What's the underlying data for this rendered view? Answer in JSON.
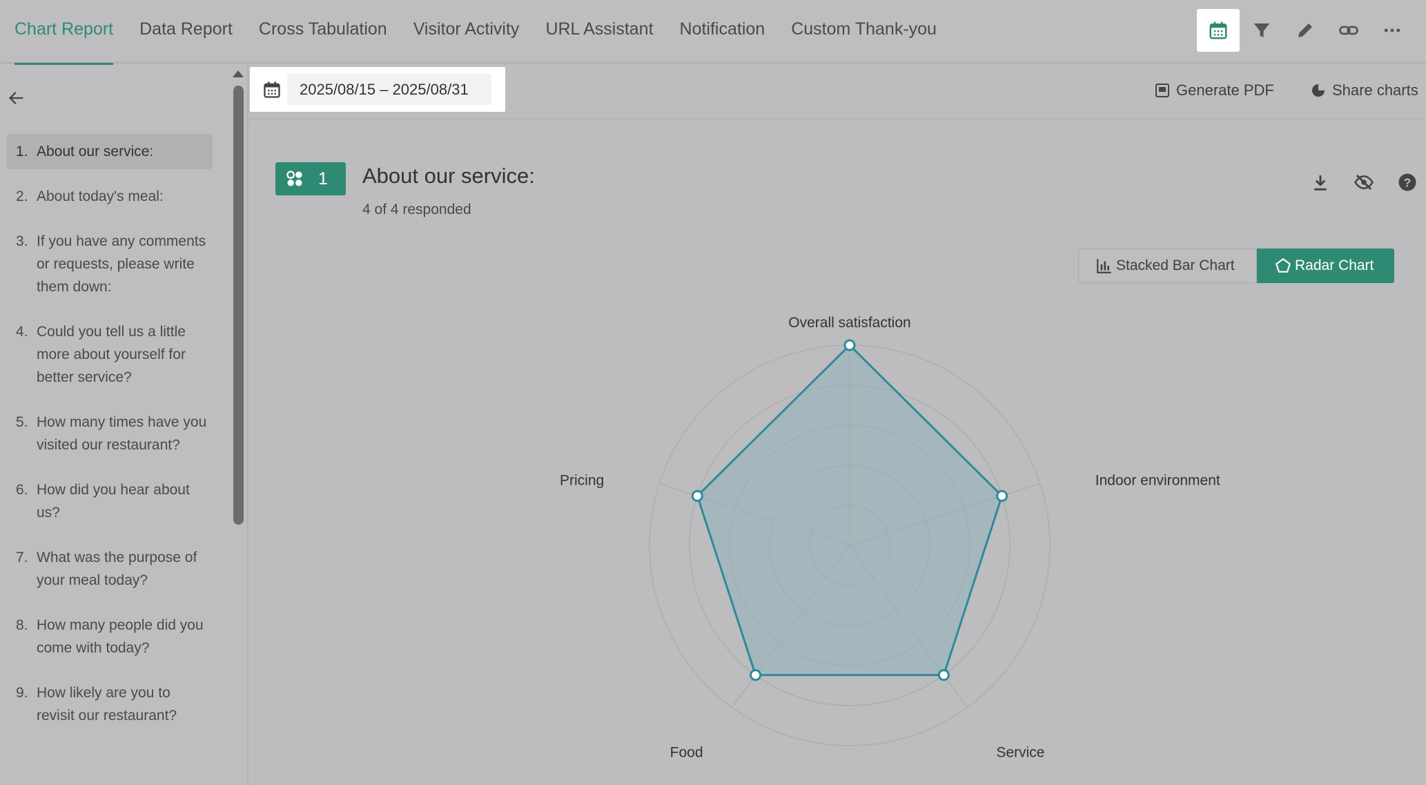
{
  "tabs": [
    {
      "label": "Chart Report",
      "active": true
    },
    {
      "label": "Data Report"
    },
    {
      "label": "Cross Tabulation"
    },
    {
      "label": "Visitor Activity"
    },
    {
      "label": "URL Assistant"
    },
    {
      "label": "Notification"
    },
    {
      "label": "Custom Thank-you"
    }
  ],
  "top_icons": [
    "calendar-icon",
    "filter-icon",
    "pencil-icon",
    "link-icon",
    "more-icon"
  ],
  "questions": [
    {
      "num": "1.",
      "text": "About our service:"
    },
    {
      "num": "2.",
      "text": "About today's meal:"
    },
    {
      "num": "3.",
      "text": "If you have any comments or requests, please write them down:"
    },
    {
      "num": "4.",
      "text": "Could you tell us a little more about yourself for better service?"
    },
    {
      "num": "5.",
      "text": "How many times have you visited our restaurant?"
    },
    {
      "num": "6.",
      "text": "How did you hear about us?"
    },
    {
      "num": "7.",
      "text": "What was the purpose of your meal today?"
    },
    {
      "num": "8.",
      "text": "How many people did you come with today?"
    },
    {
      "num": "9.",
      "text": "How likely are you to revisit our restaurant?"
    }
  ],
  "date_range": "2025/08/15 – 2025/08/31",
  "actions": {
    "generate_pdf": "Generate PDF",
    "share_charts": "Share charts"
  },
  "question_card": {
    "number": "1",
    "title": "About our service:",
    "responded": "4 of 4 responded"
  },
  "chart_toggle": {
    "stacked": "Stacked Bar Chart",
    "radar": "Radar Chart",
    "selected": "radar"
  },
  "colors": {
    "accent": "#2f8a73",
    "radar_line": "#2e8a9a",
    "radar_fill": "#8fb3ba"
  },
  "chart_data": {
    "type": "radar",
    "categories": [
      "Overall satisfaction",
      "Indoor environment",
      "Service",
      "Food",
      "Pricing"
    ],
    "values": [
      5,
      4,
      4,
      4,
      4
    ],
    "rlim": [
      0,
      5
    ],
    "grid": true
  }
}
